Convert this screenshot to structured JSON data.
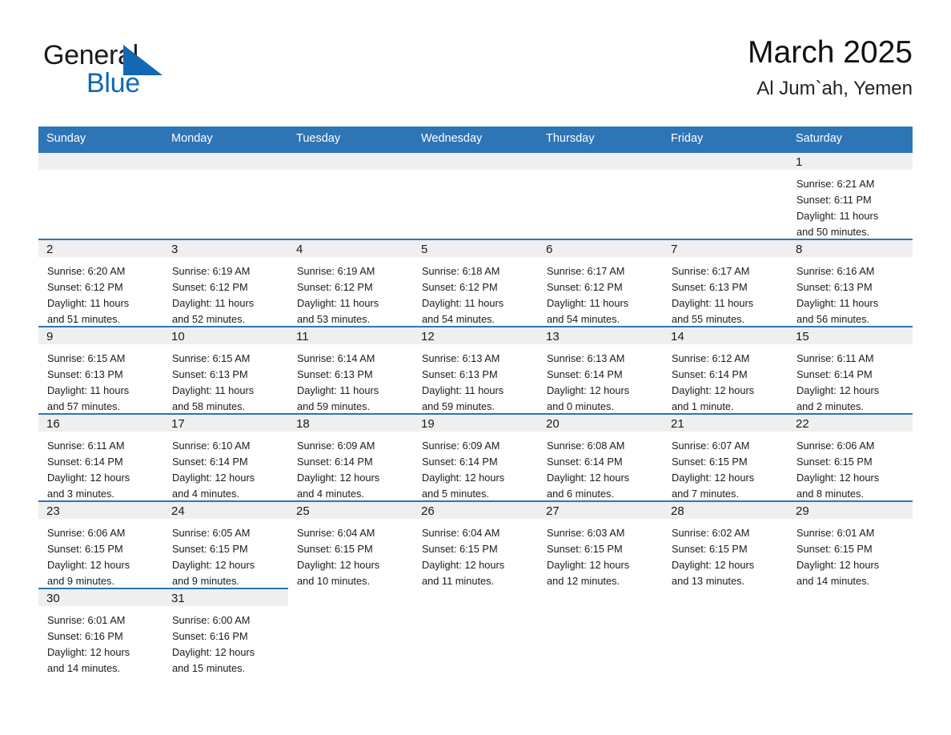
{
  "brand": {
    "name_part1": "General",
    "name_part2": "Blue",
    "color_dark": "#1a1a1a",
    "color_blue": "#1268b3"
  },
  "header": {
    "title": "March 2025",
    "subtitle": "Al Jum`ah, Yemen"
  },
  "theme": {
    "header_blue": "#2e75b6",
    "daynum_bg": "#efefef",
    "text": "#1b1b1b"
  },
  "weekdays": [
    "Sunday",
    "Monday",
    "Tuesday",
    "Wednesday",
    "Thursday",
    "Friday",
    "Saturday"
  ],
  "weeks": [
    [
      {
        "day": ""
      },
      {
        "day": ""
      },
      {
        "day": ""
      },
      {
        "day": ""
      },
      {
        "day": ""
      },
      {
        "day": ""
      },
      {
        "day": "1",
        "sunrise": "Sunrise: 6:21 AM",
        "sunset": "Sunset: 6:11 PM",
        "daylight1": "Daylight: 11 hours",
        "daylight2": "and 50 minutes."
      }
    ],
    [
      {
        "day": "2",
        "sunrise": "Sunrise: 6:20 AM",
        "sunset": "Sunset: 6:12 PM",
        "daylight1": "Daylight: 11 hours",
        "daylight2": "and 51 minutes."
      },
      {
        "day": "3",
        "sunrise": "Sunrise: 6:19 AM",
        "sunset": "Sunset: 6:12 PM",
        "daylight1": "Daylight: 11 hours",
        "daylight2": "and 52 minutes."
      },
      {
        "day": "4",
        "sunrise": "Sunrise: 6:19 AM",
        "sunset": "Sunset: 6:12 PM",
        "daylight1": "Daylight: 11 hours",
        "daylight2": "and 53 minutes."
      },
      {
        "day": "5",
        "sunrise": "Sunrise: 6:18 AM",
        "sunset": "Sunset: 6:12 PM",
        "daylight1": "Daylight: 11 hours",
        "daylight2": "and 54 minutes."
      },
      {
        "day": "6",
        "sunrise": "Sunrise: 6:17 AM",
        "sunset": "Sunset: 6:12 PM",
        "daylight1": "Daylight: 11 hours",
        "daylight2": "and 54 minutes."
      },
      {
        "day": "7",
        "sunrise": "Sunrise: 6:17 AM",
        "sunset": "Sunset: 6:13 PM",
        "daylight1": "Daylight: 11 hours",
        "daylight2": "and 55 minutes."
      },
      {
        "day": "8",
        "sunrise": "Sunrise: 6:16 AM",
        "sunset": "Sunset: 6:13 PM",
        "daylight1": "Daylight: 11 hours",
        "daylight2": "and 56 minutes."
      }
    ],
    [
      {
        "day": "9",
        "sunrise": "Sunrise: 6:15 AM",
        "sunset": "Sunset: 6:13 PM",
        "daylight1": "Daylight: 11 hours",
        "daylight2": "and 57 minutes."
      },
      {
        "day": "10",
        "sunrise": "Sunrise: 6:15 AM",
        "sunset": "Sunset: 6:13 PM",
        "daylight1": "Daylight: 11 hours",
        "daylight2": "and 58 minutes."
      },
      {
        "day": "11",
        "sunrise": "Sunrise: 6:14 AM",
        "sunset": "Sunset: 6:13 PM",
        "daylight1": "Daylight: 11 hours",
        "daylight2": "and 59 minutes."
      },
      {
        "day": "12",
        "sunrise": "Sunrise: 6:13 AM",
        "sunset": "Sunset: 6:13 PM",
        "daylight1": "Daylight: 11 hours",
        "daylight2": "and 59 minutes."
      },
      {
        "day": "13",
        "sunrise": "Sunrise: 6:13 AM",
        "sunset": "Sunset: 6:14 PM",
        "daylight1": "Daylight: 12 hours",
        "daylight2": "and 0 minutes."
      },
      {
        "day": "14",
        "sunrise": "Sunrise: 6:12 AM",
        "sunset": "Sunset: 6:14 PM",
        "daylight1": "Daylight: 12 hours",
        "daylight2": "and 1 minute."
      },
      {
        "day": "15",
        "sunrise": "Sunrise: 6:11 AM",
        "sunset": "Sunset: 6:14 PM",
        "daylight1": "Daylight: 12 hours",
        "daylight2": "and 2 minutes."
      }
    ],
    [
      {
        "day": "16",
        "sunrise": "Sunrise: 6:11 AM",
        "sunset": "Sunset: 6:14 PM",
        "daylight1": "Daylight: 12 hours",
        "daylight2": "and 3 minutes."
      },
      {
        "day": "17",
        "sunrise": "Sunrise: 6:10 AM",
        "sunset": "Sunset: 6:14 PM",
        "daylight1": "Daylight: 12 hours",
        "daylight2": "and 4 minutes."
      },
      {
        "day": "18",
        "sunrise": "Sunrise: 6:09 AM",
        "sunset": "Sunset: 6:14 PM",
        "daylight1": "Daylight: 12 hours",
        "daylight2": "and 4 minutes."
      },
      {
        "day": "19",
        "sunrise": "Sunrise: 6:09 AM",
        "sunset": "Sunset: 6:14 PM",
        "daylight1": "Daylight: 12 hours",
        "daylight2": "and 5 minutes."
      },
      {
        "day": "20",
        "sunrise": "Sunrise: 6:08 AM",
        "sunset": "Sunset: 6:14 PM",
        "daylight1": "Daylight: 12 hours",
        "daylight2": "and 6 minutes."
      },
      {
        "day": "21",
        "sunrise": "Sunrise: 6:07 AM",
        "sunset": "Sunset: 6:15 PM",
        "daylight1": "Daylight: 12 hours",
        "daylight2": "and 7 minutes."
      },
      {
        "day": "22",
        "sunrise": "Sunrise: 6:06 AM",
        "sunset": "Sunset: 6:15 PM",
        "daylight1": "Daylight: 12 hours",
        "daylight2": "and 8 minutes."
      }
    ],
    [
      {
        "day": "23",
        "sunrise": "Sunrise: 6:06 AM",
        "sunset": "Sunset: 6:15 PM",
        "daylight1": "Daylight: 12 hours",
        "daylight2": "and 9 minutes."
      },
      {
        "day": "24",
        "sunrise": "Sunrise: 6:05 AM",
        "sunset": "Sunset: 6:15 PM",
        "daylight1": "Daylight: 12 hours",
        "daylight2": "and 9 minutes."
      },
      {
        "day": "25",
        "sunrise": "Sunrise: 6:04 AM",
        "sunset": "Sunset: 6:15 PM",
        "daylight1": "Daylight: 12 hours",
        "daylight2": "and 10 minutes."
      },
      {
        "day": "26",
        "sunrise": "Sunrise: 6:04 AM",
        "sunset": "Sunset: 6:15 PM",
        "daylight1": "Daylight: 12 hours",
        "daylight2": "and 11 minutes."
      },
      {
        "day": "27",
        "sunrise": "Sunrise: 6:03 AM",
        "sunset": "Sunset: 6:15 PM",
        "daylight1": "Daylight: 12 hours",
        "daylight2": "and 12 minutes."
      },
      {
        "day": "28",
        "sunrise": "Sunrise: 6:02 AM",
        "sunset": "Sunset: 6:15 PM",
        "daylight1": "Daylight: 12 hours",
        "daylight2": "and 13 minutes."
      },
      {
        "day": "29",
        "sunrise": "Sunrise: 6:01 AM",
        "sunset": "Sunset: 6:15 PM",
        "daylight1": "Daylight: 12 hours",
        "daylight2": "and 14 minutes."
      }
    ],
    [
      {
        "day": "30",
        "sunrise": "Sunrise: 6:01 AM",
        "sunset": "Sunset: 6:16 PM",
        "daylight1": "Daylight: 12 hours",
        "daylight2": "and 14 minutes."
      },
      {
        "day": "31",
        "sunrise": "Sunrise: 6:00 AM",
        "sunset": "Sunset: 6:16 PM",
        "daylight1": "Daylight: 12 hours",
        "daylight2": "and 15 minutes."
      },
      {
        "day": ""
      },
      {
        "day": ""
      },
      {
        "day": ""
      },
      {
        "day": ""
      },
      {
        "day": ""
      }
    ]
  ]
}
